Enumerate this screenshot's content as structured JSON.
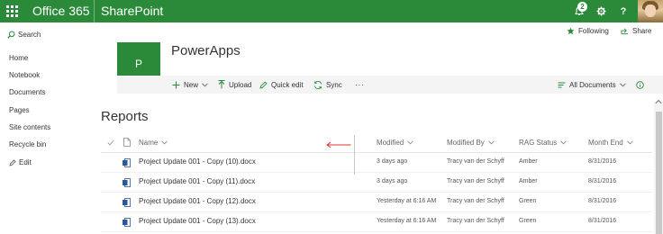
{
  "suite": {
    "brand": "Office 365",
    "app": "SharePoint",
    "notification_count": "2",
    "help_label": "?",
    "icons": [
      "app-launcher-icon",
      "bell-icon",
      "gear-icon",
      "help-icon"
    ]
  },
  "leftnav": {
    "search_label": "Search",
    "items": [
      "Home",
      "Notebook",
      "Documents",
      "Pages",
      "Site contents",
      "Recycle bin"
    ],
    "edit_label": "Edit"
  },
  "site": {
    "logo_letter": "P",
    "title": "PowerApps",
    "following_label": "Following",
    "share_label": "Share"
  },
  "commands": {
    "new": "New",
    "upload": "Upload",
    "quick_edit": "Quick edit",
    "sync": "Sync",
    "more": "···",
    "view": "All Documents"
  },
  "list": {
    "title": "Reports",
    "columns": [
      "Name",
      "Modified",
      "Modified By",
      "RAG Status",
      "Month End"
    ],
    "rows": [
      {
        "name": "Project Update 001 - Copy (10).docx",
        "modified": "3 days ago",
        "modified_by": "Tracy van der Schyff",
        "rag": "Amber",
        "month_end": "8/31/2016"
      },
      {
        "name": "Project Update 001 - Copy (11).docx",
        "modified": "3 days ago",
        "modified_by": "Tracy van der Schyff",
        "rag": "Amber",
        "month_end": "8/31/2016"
      },
      {
        "name": "Project Update 001 - Copy (12).docx",
        "modified": "Yesterday at 6:16 AM",
        "modified_by": "Tracy van der Schyff",
        "rag": "Green",
        "month_end": "8/31/2016"
      },
      {
        "name": "Project Update 001 - Copy (13).docx",
        "modified": "Yesterday at 6:16 AM",
        "modified_by": "Tracy van der Schyff",
        "rag": "Green",
        "month_end": "8/31/2016"
      }
    ]
  },
  "colors": {
    "brand_green": "#2a8a3a",
    "word_blue": "#2b579a",
    "annotation_red": "#d9362b"
  }
}
